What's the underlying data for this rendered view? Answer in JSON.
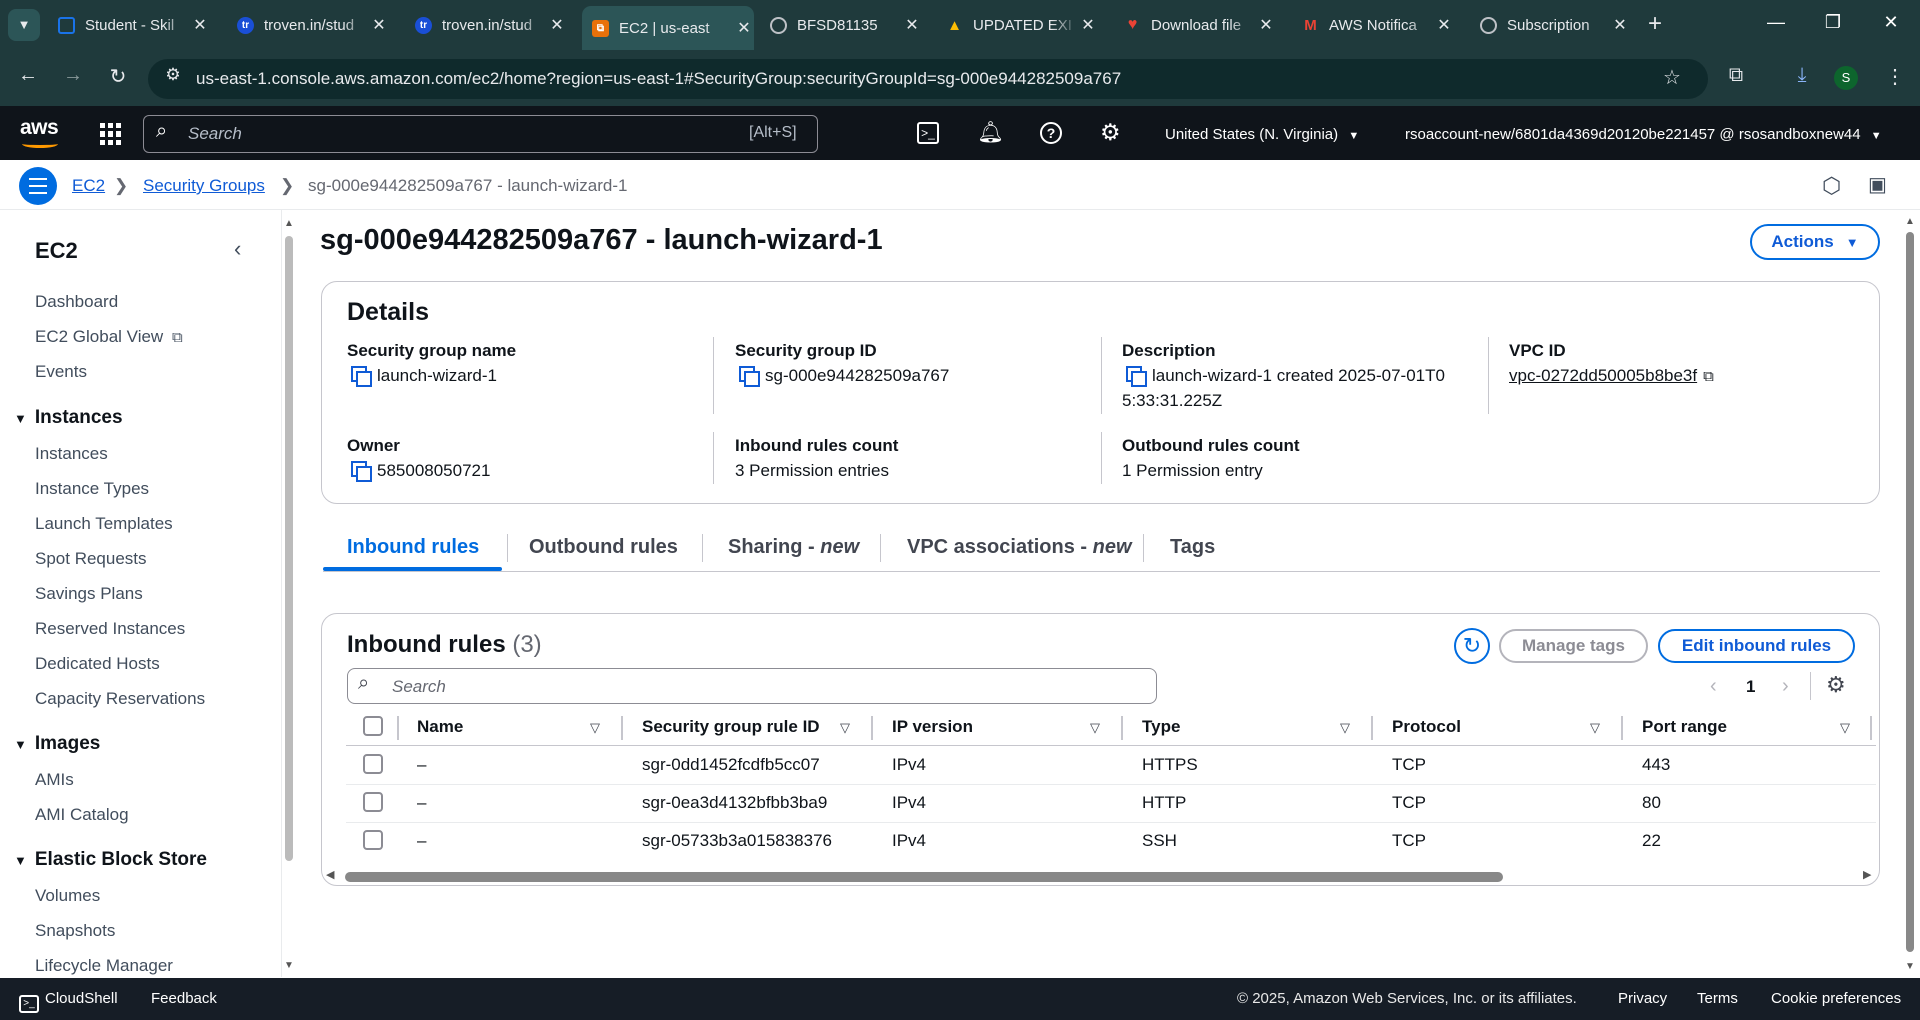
{
  "browser": {
    "tabs": [
      {
        "title": "Student - Skil",
        "fav_color": "#1a73e8",
        "fav_glyph": "▢"
      },
      {
        "title": "troven.in/stud",
        "fav_color": "#1a4fd6",
        "fav_glyph": "tr"
      },
      {
        "title": "troven.in/stud",
        "fav_color": "#1a4fd6",
        "fav_glyph": "tr"
      },
      {
        "title": "EC2 | us-east",
        "fav_color": "#e8710a",
        "fav_glyph": "⧉"
      },
      {
        "title": "BFSD81135",
        "fav_color": "#5f6368",
        "fav_glyph": "◍"
      },
      {
        "title": "UPDATED EXI",
        "fav_color": "#34a853",
        "fav_glyph": "▲"
      },
      {
        "title": "Download file",
        "fav_color": "#d93025",
        "fav_glyph": "♥"
      },
      {
        "title": "AWS Notifica",
        "fav_color": "#ea4335",
        "fav_glyph": "M"
      },
      {
        "title": "Subscription",
        "fav_color": "#5f6368",
        "fav_glyph": "◍"
      }
    ],
    "url": "us-east-1.console.aws.amazon.com/ec2/home?region=us-east-1#SecurityGroup:securityGroupId=sg-000e944282509a767",
    "profile_initial": "S"
  },
  "aws_header": {
    "logo": "aws",
    "search_placeholder": "Search",
    "search_shortcut": "[Alt+S]",
    "region": "United States (N. Virginia)",
    "account": "rsoaccount-new/6801da4369d20120be221457 @ rsosandboxnew44"
  },
  "breadcrumb": {
    "items": [
      "EC2",
      "Security Groups",
      "sg-000e944282509a767 - launch-wizard-1"
    ]
  },
  "sidebar": {
    "title": "EC2",
    "top_items": [
      "Dashboard",
      "EC2 Global View",
      "Events"
    ],
    "sections": [
      {
        "title": "Instances",
        "items": [
          "Instances",
          "Instance Types",
          "Launch Templates",
          "Spot Requests",
          "Savings Plans",
          "Reserved Instances",
          "Dedicated Hosts",
          "Capacity Reservations"
        ]
      },
      {
        "title": "Images",
        "items": [
          "AMIs",
          "AMI Catalog"
        ]
      },
      {
        "title": "Elastic Block Store",
        "items": [
          "Volumes",
          "Snapshots",
          "Lifecycle Manager"
        ]
      }
    ]
  },
  "page": {
    "title": "sg-000e944282509a767 - launch-wizard-1",
    "actions_label": "Actions"
  },
  "details": {
    "heading": "Details",
    "sg_name_label": "Security group name",
    "sg_name": "launch-wizard-1",
    "sg_id_label": "Security group ID",
    "sg_id": "sg-000e944282509a767",
    "description_label": "Description",
    "description_line1": "launch-wizard-1 created 2025-07-01T0",
    "description_line2": "5:33:31.225Z",
    "vpc_label": "VPC ID",
    "vpc_id": "vpc-0272dd50005b8be3f",
    "owner_label": "Owner",
    "owner": "585008050721",
    "inbound_count_label": "Inbound rules count",
    "inbound_count": "3 Permission entries",
    "outbound_count_label": "Outbound rules count",
    "outbound_count": "1 Permission entry"
  },
  "tabs": {
    "inbound": "Inbound rules",
    "outbound": "Outbound rules",
    "sharing": "Sharing - ",
    "sharing_new": "new",
    "vpc_assoc": "VPC associations - ",
    "vpc_assoc_new": "new",
    "tags": "Tags"
  },
  "rules_panel": {
    "heading": "Inbound rules",
    "count": "(3)",
    "manage_tags": "Manage tags",
    "edit_rules": "Edit inbound rules",
    "search_placeholder": "Search",
    "page_number": "1",
    "columns": [
      "Name",
      "Security group rule ID",
      "IP version",
      "Type",
      "Protocol",
      "Port range"
    ],
    "rows": [
      {
        "name": "–",
        "rule_id": "sgr-0dd1452fcdfb5cc07",
        "ip": "IPv4",
        "type": "HTTPS",
        "protocol": "TCP",
        "port": "443"
      },
      {
        "name": "–",
        "rule_id": "sgr-0ea3d4132bfbb3ba9",
        "ip": "IPv4",
        "type": "HTTP",
        "protocol": "TCP",
        "port": "80"
      },
      {
        "name": "–",
        "rule_id": "sgr-05733b3a015838376",
        "ip": "IPv4",
        "type": "SSH",
        "protocol": "TCP",
        "port": "22"
      }
    ]
  },
  "footer": {
    "cloudshell": "CloudShell",
    "feedback": "Feedback",
    "copyright": "© 2025, Amazon Web Services, Inc. or its affiliates.",
    "privacy": "Privacy",
    "terms": "Terms",
    "cookies": "Cookie preferences"
  },
  "colors": {
    "accent": "#006ce0",
    "link": "#0f5bd6",
    "chrome": "#1f3a3c",
    "aws_header": "#0f141a"
  }
}
